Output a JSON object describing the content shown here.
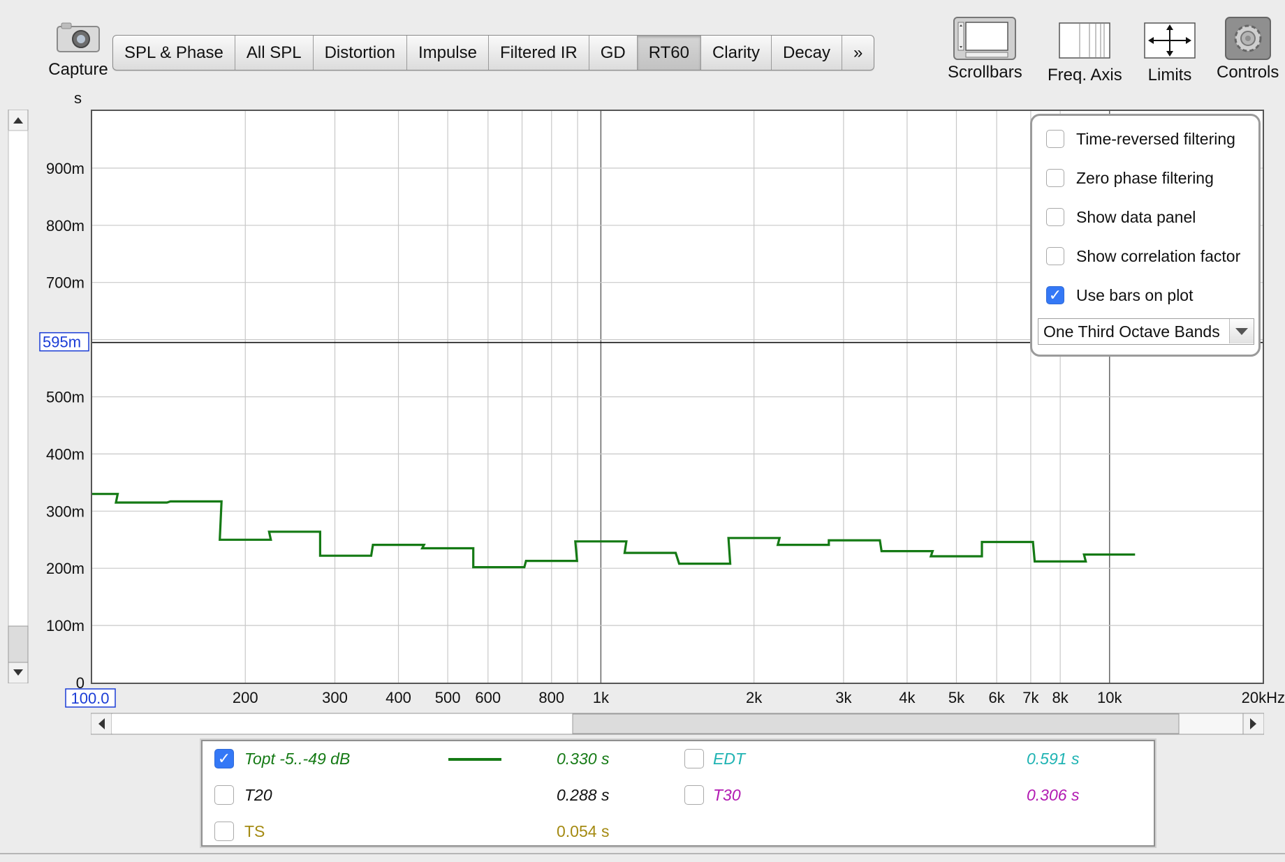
{
  "toolbar": {
    "capture_label": "Capture",
    "tabs": [
      {
        "label": "SPL & Phase",
        "active": false
      },
      {
        "label": "All SPL",
        "active": false
      },
      {
        "label": "Distortion",
        "active": false
      },
      {
        "label": "Impulse",
        "active": false
      },
      {
        "label": "Filtered IR",
        "active": false
      },
      {
        "label": "GD",
        "active": false
      },
      {
        "label": "RT60",
        "active": true
      },
      {
        "label": "Clarity",
        "active": false
      },
      {
        "label": "Decay",
        "active": false
      },
      {
        "label": "»",
        "active": false
      }
    ],
    "tools": {
      "scrollbars": "Scrollbars",
      "freq_axis": "Freq. Axis",
      "limits": "Limits",
      "controls": "Controls"
    }
  },
  "options": {
    "time_reversed": {
      "label": "Time-reversed filtering",
      "checked": false
    },
    "zero_phase": {
      "label": "Zero phase filtering",
      "checked": false
    },
    "show_data_panel": {
      "label": "Show data panel",
      "checked": false
    },
    "show_correlation": {
      "label": "Show correlation factor",
      "checked": false
    },
    "use_bars": {
      "label": "Use bars on plot",
      "checked": true
    },
    "band_select": "One Third Octave Bands"
  },
  "legend": {
    "topt": {
      "label": "Topt -5..-49 dB",
      "value": "0.330 s",
      "checked": true,
      "color": "#157a15"
    },
    "t20": {
      "label": "T20",
      "value": "0.288 s",
      "checked": false,
      "color": "#111111"
    },
    "ts": {
      "label": "TS",
      "value": "0.054 s",
      "checked": false,
      "color": "#a48a12"
    },
    "edt": {
      "label": "EDT",
      "value": "0.591 s",
      "checked": false,
      "color": "#1fb3b3"
    },
    "t30": {
      "label": "T30",
      "value": "0.306 s",
      "checked": false,
      "color": "#b21ab2"
    }
  },
  "chart_data": {
    "type": "line",
    "step": true,
    "x_scale": "log",
    "xlim": [
      100,
      20000
    ],
    "ylim": [
      0,
      1.0
    ],
    "y_unit": "s",
    "y_ticks": [
      {
        "value": 0,
        "label": "0"
      },
      {
        "value": 0.1,
        "label": "100m"
      },
      {
        "value": 0.2,
        "label": "200m"
      },
      {
        "value": 0.3,
        "label": "300m"
      },
      {
        "value": 0.4,
        "label": "400m"
      },
      {
        "value": 0.5,
        "label": "500m"
      },
      {
        "value": 0.7,
        "label": "700m"
      },
      {
        "value": 0.8,
        "label": "800m"
      },
      {
        "value": 0.9,
        "label": "900m"
      }
    ],
    "x_ticks": [
      {
        "value": 200,
        "label": "200"
      },
      {
        "value": 300,
        "label": "300"
      },
      {
        "value": 400,
        "label": "400"
      },
      {
        "value": 500,
        "label": "500"
      },
      {
        "value": 600,
        "label": "600"
      },
      {
        "value": 800,
        "label": "800"
      },
      {
        "value": 1000,
        "label": "1k"
      },
      {
        "value": 2000,
        "label": "2k"
      },
      {
        "value": 3000,
        "label": "3k"
      },
      {
        "value": 4000,
        "label": "4k"
      },
      {
        "value": 5000,
        "label": "5k"
      },
      {
        "value": 6000,
        "label": "6k"
      },
      {
        "value": 7000,
        "label": "7k"
      },
      {
        "value": 8000,
        "label": "8k"
      },
      {
        "value": 10000,
        "label": "10k"
      },
      {
        "value": 20000,
        "label": "20kHz"
      }
    ],
    "x_grid_minor": [
      700,
      900
    ],
    "x_start_label": "100.0",
    "cursor": {
      "value": 0.595,
      "label": "595m"
    },
    "grid": true,
    "series": [
      {
        "name": "Topt -5..-49 dB",
        "color": "#157a15",
        "bands": [
          {
            "f": 100,
            "v": 0.33
          },
          {
            "f": 125,
            "v": 0.315
          },
          {
            "f": 160,
            "v": 0.317
          },
          {
            "f": 200,
            "v": 0.25
          },
          {
            "f": 250,
            "v": 0.264
          },
          {
            "f": 315,
            "v": 0.222
          },
          {
            "f": 400,
            "v": 0.241
          },
          {
            "f": 500,
            "v": 0.235
          },
          {
            "f": 630,
            "v": 0.202
          },
          {
            "f": 800,
            "v": 0.213
          },
          {
            "f": 1000,
            "v": 0.247
          },
          {
            "f": 1250,
            "v": 0.227
          },
          {
            "f": 1600,
            "v": 0.208
          },
          {
            "f": 2000,
            "v": 0.253
          },
          {
            "f": 2500,
            "v": 0.241
          },
          {
            "f": 3150,
            "v": 0.249
          },
          {
            "f": 4000,
            "v": 0.23
          },
          {
            "f": 5000,
            "v": 0.221
          },
          {
            "f": 6300,
            "v": 0.246
          },
          {
            "f": 8000,
            "v": 0.212
          },
          {
            "f": 10000,
            "v": 0.224
          }
        ]
      }
    ]
  }
}
